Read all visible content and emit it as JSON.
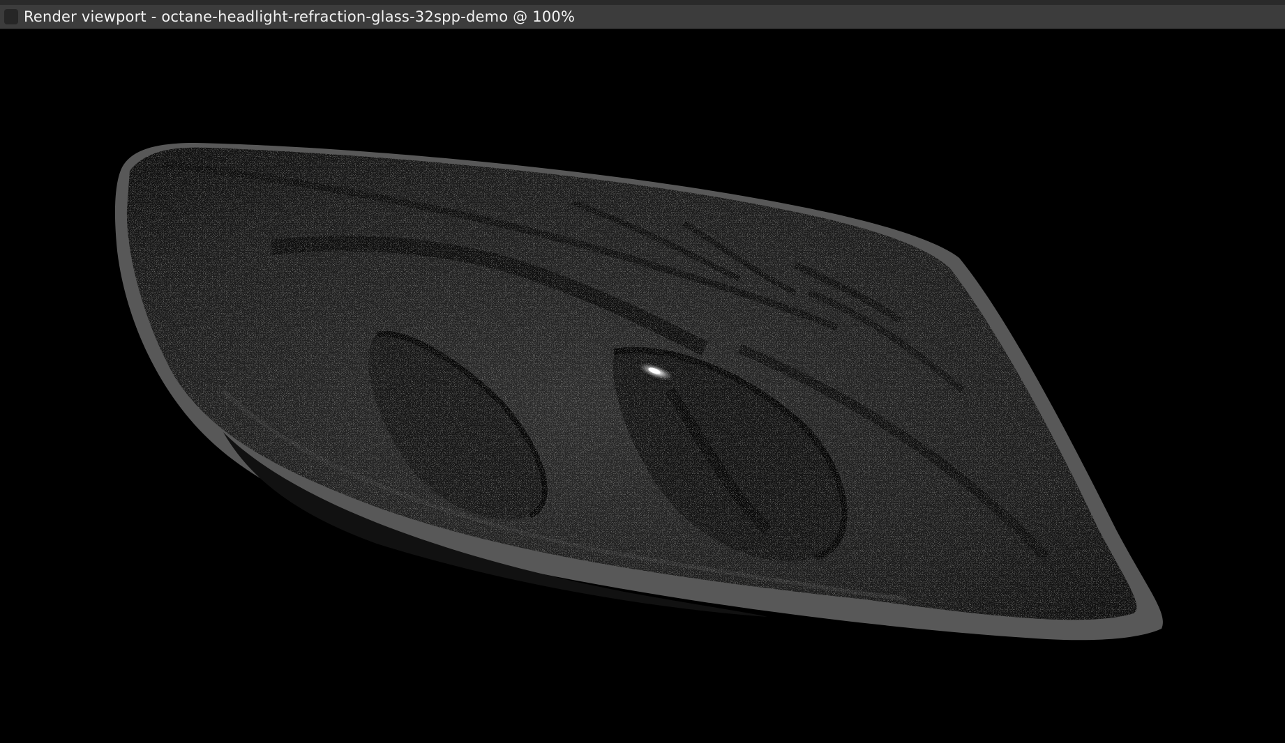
{
  "window": {
    "title": "Render viewport - octane-headlight-refraction-glass-32spp-demo @ 100%",
    "title_icon": "window-badge-icon"
  },
  "viewport": {
    "background": "#000000",
    "render_subject": "headlight-render",
    "zoom_level": "100%"
  },
  "colors": {
    "titlebar": "#3c3c3c",
    "housing_rim": "#585858",
    "housing_inner": "#1e1e1e",
    "highlight": "#ffffff"
  }
}
